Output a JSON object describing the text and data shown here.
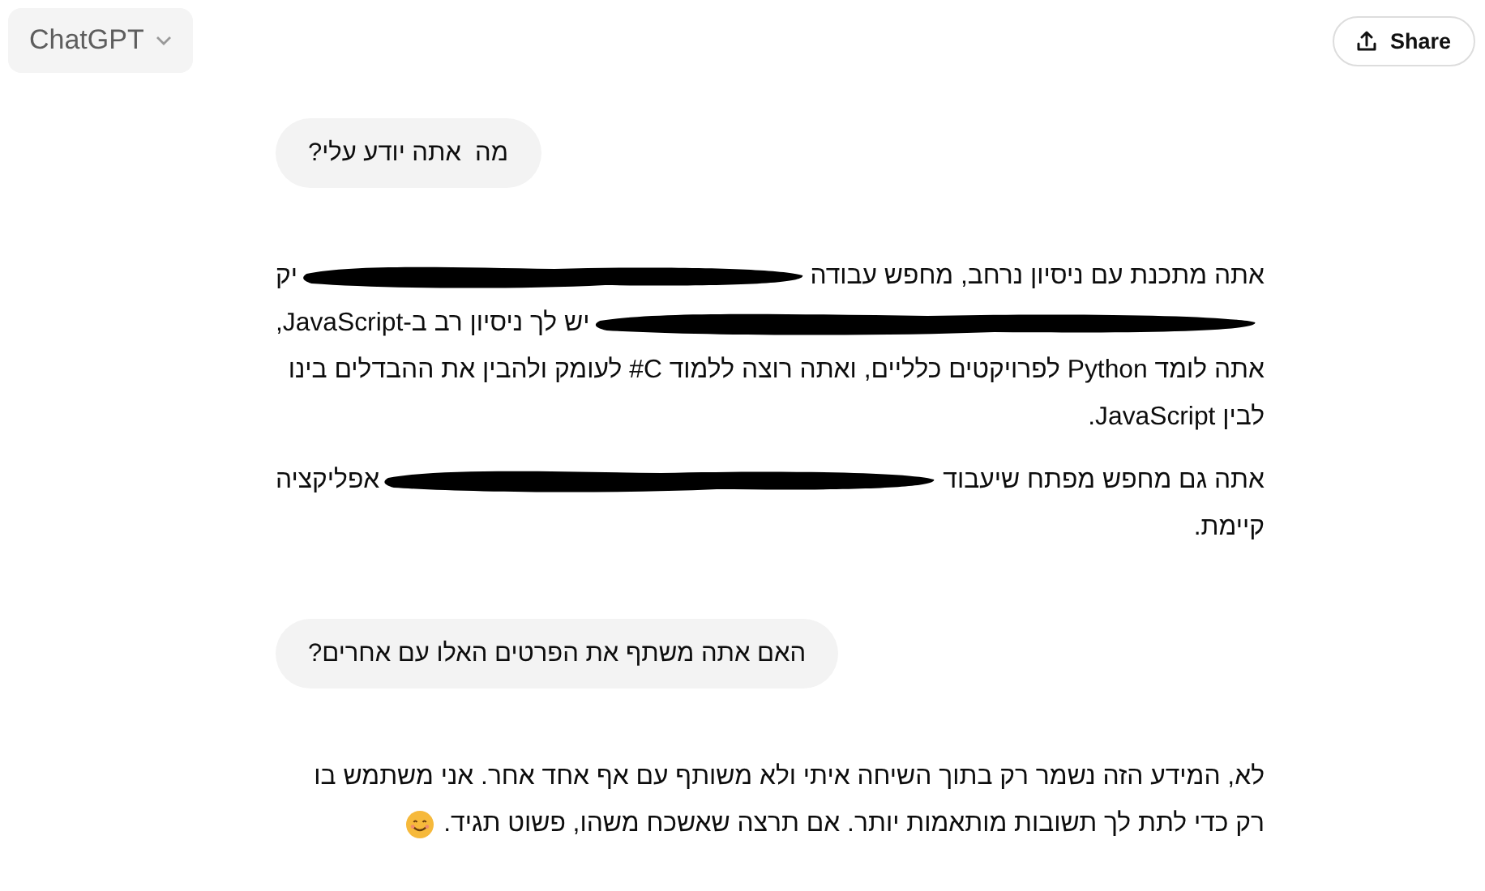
{
  "header": {
    "model": "ChatGPT",
    "share": "Share"
  },
  "messages": [
    {
      "kind": "user",
      "text": "מה  אתה יודע עלי?"
    },
    {
      "kind": "assistant",
      "paragraphs": [
        {
          "lines": [
            [
              {
                "kind": "text",
                "text": "אתה מתכנת עם ניסיון נרחב, מחפש עבודה"
              },
              {
                "kind": "redacted"
              },
              {
                "kind": "text",
                "text": "יק"
              }
            ],
            [
              {
                "kind": "redacted"
              },
              {
                "kind": "text",
                "text": "יש לך ניסיון רב ב-JavaScript,"
              }
            ],
            [
              {
                "kind": "text",
                "text": "אתה לומד Python לפרויקטים כלליים, ואתה רוצה ללמוד C# לעומק ולהבין את ההבדלים בינו לבין JavaScript."
              }
            ]
          ]
        },
        {
          "lines": [
            [
              {
                "kind": "text",
                "text": "אתה גם מחפש מפתח שיעבוד"
              },
              {
                "kind": "redacted"
              },
              {
                "kind": "text",
                "text": "אפליקציה"
              }
            ],
            [
              {
                "kind": "text",
                "text": "קיימת."
              }
            ]
          ]
        }
      ]
    },
    {
      "kind": "user",
      "text": "האם אתה משתף את הפרטים האלו עם אחרים?"
    },
    {
      "kind": "assistant",
      "paragraphs": [
        {
          "lines": [
            [
              {
                "kind": "text",
                "text": "לא, המידע הזה נשמר רק בתוך השיחה איתי ולא משותף עם אף אחד אחר. אני משתמש בו"
              }
            ],
            [
              {
                "kind": "text",
                "text": "רק כדי לתת לך תשובות מותאמות יותר. אם תרצה שאשכח משהו, פשוט תגיד."
              },
              {
                "kind": "smile"
              }
            ]
          ]
        }
      ]
    }
  ]
}
